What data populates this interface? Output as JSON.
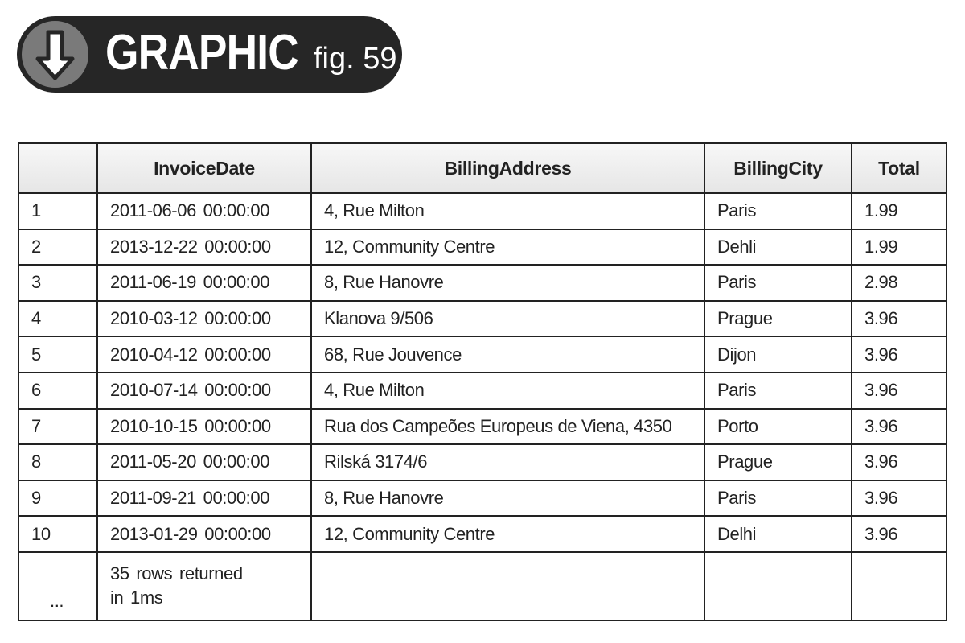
{
  "badge": {
    "icon": "arrow-down-circle-icon",
    "title": "GRAPHIC",
    "subtitle": "fig. 59"
  },
  "table": {
    "columns": [
      "",
      "InvoiceDate",
      "BillingAddress",
      "BillingCity",
      "Total"
    ],
    "rows": [
      {
        "num": "1",
        "date": "2011-06-06 00:00:00",
        "address": "4, Rue Milton",
        "city": "Paris",
        "total": "1.99"
      },
      {
        "num": "2",
        "date": "2013-12-22 00:00:00",
        "address": "12, Community Centre",
        "city": "Dehli",
        "total": "1.99"
      },
      {
        "num": "3",
        "date": "2011-06-19 00:00:00",
        "address": "8, Rue Hanovre",
        "city": "Paris",
        "total": "2.98"
      },
      {
        "num": "4",
        "date": "2010-03-12 00:00:00",
        "address": "Klanova 9/506",
        "city": "Prague",
        "total": "3.96"
      },
      {
        "num": "5",
        "date": "2010-04-12 00:00:00",
        "address": "68, Rue Jouvence",
        "city": "Dijon",
        "total": "3.96"
      },
      {
        "num": "6",
        "date": "2010-07-14 00:00:00",
        "address": "4, Rue Milton",
        "city": "Paris",
        "total": "3.96"
      },
      {
        "num": "7",
        "date": "2010-10-15 00:00:00",
        "address": "Rua dos Campeões Europeus de Viena, 4350",
        "city": "Porto",
        "total": "3.96"
      },
      {
        "num": "8",
        "date": "2011-05-20 00:00:00",
        "address": "Rilská 3174/6",
        "city": "Prague",
        "total": "3.96"
      },
      {
        "num": "9",
        "date": "2011-09-21 00:00:00",
        "address": "8, Rue Hanovre",
        "city": "Paris",
        "total": "3.96"
      },
      {
        "num": "10",
        "date": "2013-01-29 00:00:00",
        "address": "12, Community Centre",
        "city": "Delhi",
        "total": "3.96"
      }
    ],
    "footer": {
      "ellipsis": "...",
      "status_line1": "35 rows returned",
      "status_line2": "in 1ms"
    }
  }
}
